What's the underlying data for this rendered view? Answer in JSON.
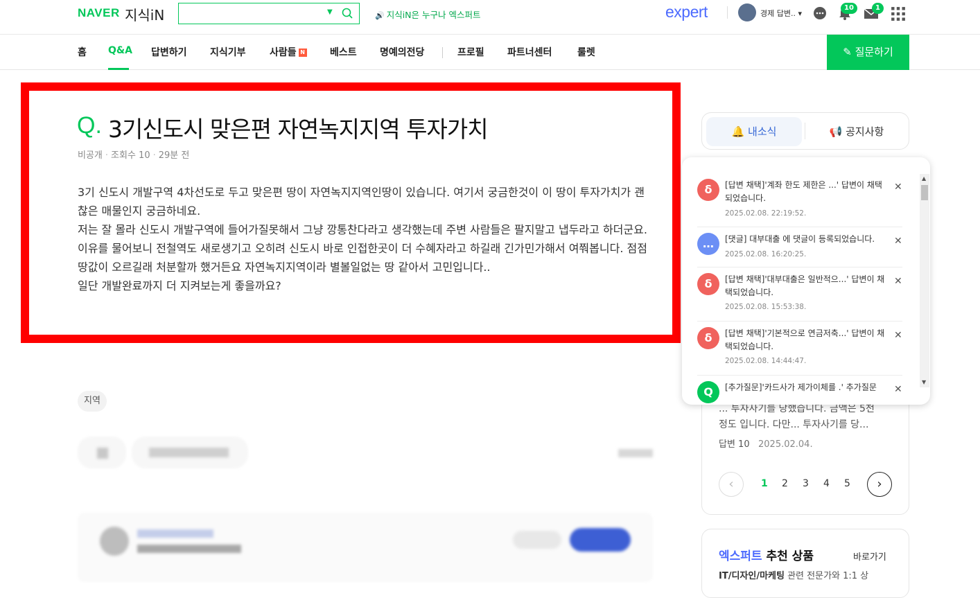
{
  "header": {
    "naver_logo": "NAVER",
    "kin_logo": "지식iN",
    "search_value": "",
    "promo_text": "지식iN은 누구나 엑스퍼트",
    "expert_logo": "expert",
    "username": "경제 답변..",
    "alarm_badge": "10",
    "mail_badge": "1"
  },
  "nav": {
    "items": [
      "홈",
      "Q&A",
      "답변하기",
      "지식기부",
      "사람들",
      "베스트",
      "명예의전당",
      "프로필",
      "파트너센터",
      "룰렛"
    ],
    "active": "Q&A",
    "new_badge": "N",
    "ask_button": "질문하기"
  },
  "question": {
    "q_mark": "Q.",
    "title": "3기신도시 맞은편 자연녹지지역 투자가치",
    "author": "비공개",
    "views": "조회수 10",
    "time": "29분 전",
    "body": "3기 신도시 개발구역 4차선도로 두고 맞은편 땅이 자연녹지지역인땅이 있습니다. 여기서 궁금한것이 이 땅이 투자가치가 괜찮은 매물인지 궁금하네요.\n저는 잘 몰라 신도시 개발구역에 들어가질못해서 그냥 깡통찬다라고 생각했는데 주변 사람들은 팔지말고 냅두라고 하더군요. 이유를 물어보니 전철역도 새로생기고 오히려 신도시 바로 인접한곳이 더 수혜자라고 하길래 긴가민가해서 여쭤봅니다. 점점 땅값이 오르길래 처분할까 했거든요 자연녹지지역이라 별볼일없는 땅 같아서 고민입니다..\n일단 개발완료까지 더 지켜보는게 좋을까요?",
    "tag": "지역"
  },
  "sidebar": {
    "tab_news": "내소식",
    "tab_notice": "공지사항",
    "notifications": [
      {
        "text": "[답변 채택]'계좌 한도 제한은 ...' 답변이 채택되었습니다.",
        "date": "2025.02.08. 22:19:52.",
        "icon": "chosen-icon",
        "color": "#f0625d"
      },
      {
        "text": "[댓글] 대부대출 에 댓글이 등록되었습니다.",
        "date": "2025.02.08. 16:20:25.",
        "icon": "comment-icon",
        "color": "#6c8ff5"
      },
      {
        "text": "[답변 채택]'대부대출은 일반적으...' 답변이 채택되었습니다.",
        "date": "2025.02.08. 15:53:38.",
        "icon": "chosen-icon",
        "color": "#f0625d"
      },
      {
        "text": "[답변 채택]'기본적으로 연금저축...' 답변이 채택되었습니다.",
        "date": "2025.02.08. 14:44:47.",
        "icon": "chosen-icon",
        "color": "#f0625d"
      },
      {
        "text": "[추가질문]'카드사가 제가이체를 .' 추가질문",
        "date": "",
        "icon": "question-icon",
        "color": "#03c75a"
      }
    ],
    "snippet_line1": "... 투자사기를 당했습니다. 금액은 5천",
    "snippet_line2": "정도 입니다. 다만... 투자사기를 당...",
    "snippet_answers": "답변 10",
    "snippet_date": "2025.02.04.",
    "pages": [
      "1",
      "2",
      "3",
      "4",
      "5"
    ],
    "current_page": "1",
    "expert_title_hl": "엑스퍼트",
    "expert_title_rest": " 추천 상품",
    "expert_link": "바로가기",
    "expert_sub_bold": "IT/디자인/마케팅",
    "expert_sub_rest": " 관련 전문가와 1:1 상"
  }
}
